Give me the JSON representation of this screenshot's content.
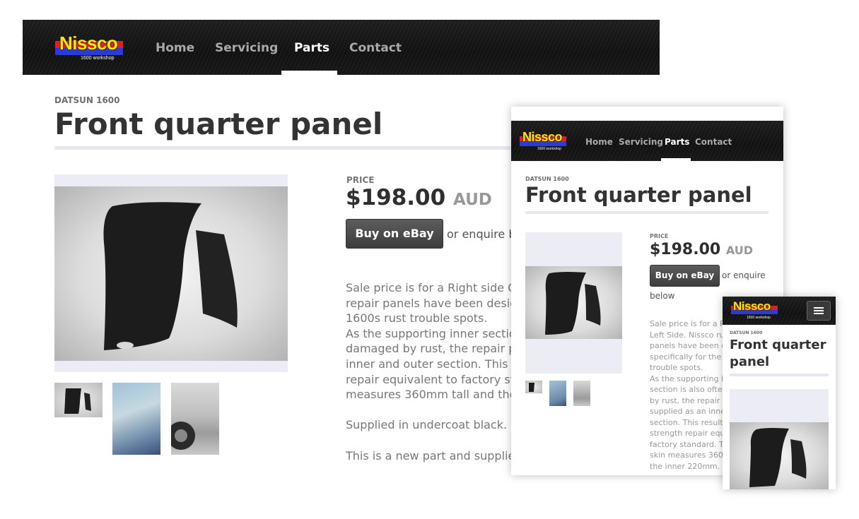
{
  "brand": {
    "name": "Nissco",
    "tagline": "1600 workshop"
  },
  "nav": {
    "items": [
      {
        "label": "Home"
      },
      {
        "label": "Servicing"
      },
      {
        "label": "Parts"
      },
      {
        "label": "Contact"
      }
    ],
    "active": "Parts"
  },
  "product": {
    "category": "DATSUN 1600",
    "title": "Front quarter panel",
    "title_line1": "Front quarter",
    "title_line2": "panel",
    "price_label": "PRICE",
    "price": "$198.00",
    "currency": "AUD",
    "buy_label": "Buy on eBay",
    "enquire_desktop": "or enquire b",
    "enquire_tablet": "or enquire",
    "enquire_tablet_2": "below"
  },
  "desktop_description": [
    "Sale price is for a Right side OR",
    "repair panels have been designe",
    "1600s rust trouble spots.",
    "As the supporting inner section",
    "damaged by rust, the repair par",
    "inner and outer section. This res",
    "repair equivalent to factory stan",
    "measures 360mm tall and the in",
    "",
    "Supplied in undercoat black.",
    "",
    "This is a new part and supplied"
  ],
  "tablet_description": [
    "Sale price is for a Ri",
    "Left Side. Nissco ru",
    "panels have been d",
    "specifically for the 1",
    "trouble spots.",
    "As the supporting in",
    "section is also ofter",
    "by rust, the repair p",
    "supplied as an inne",
    "section. This results",
    "strength repair equ",
    "factory standard. Th",
    "skin measures 360r",
    "the inner 220mm."
  ],
  "colors": {
    "accent_red": "#e02020",
    "accent_blue": "#2a3bd8",
    "logo_yellow": "#f6e21a",
    "nav_bg": "#141414",
    "rule": "#e7e7f1"
  },
  "icons": {
    "menu": "hamburger-icon"
  }
}
